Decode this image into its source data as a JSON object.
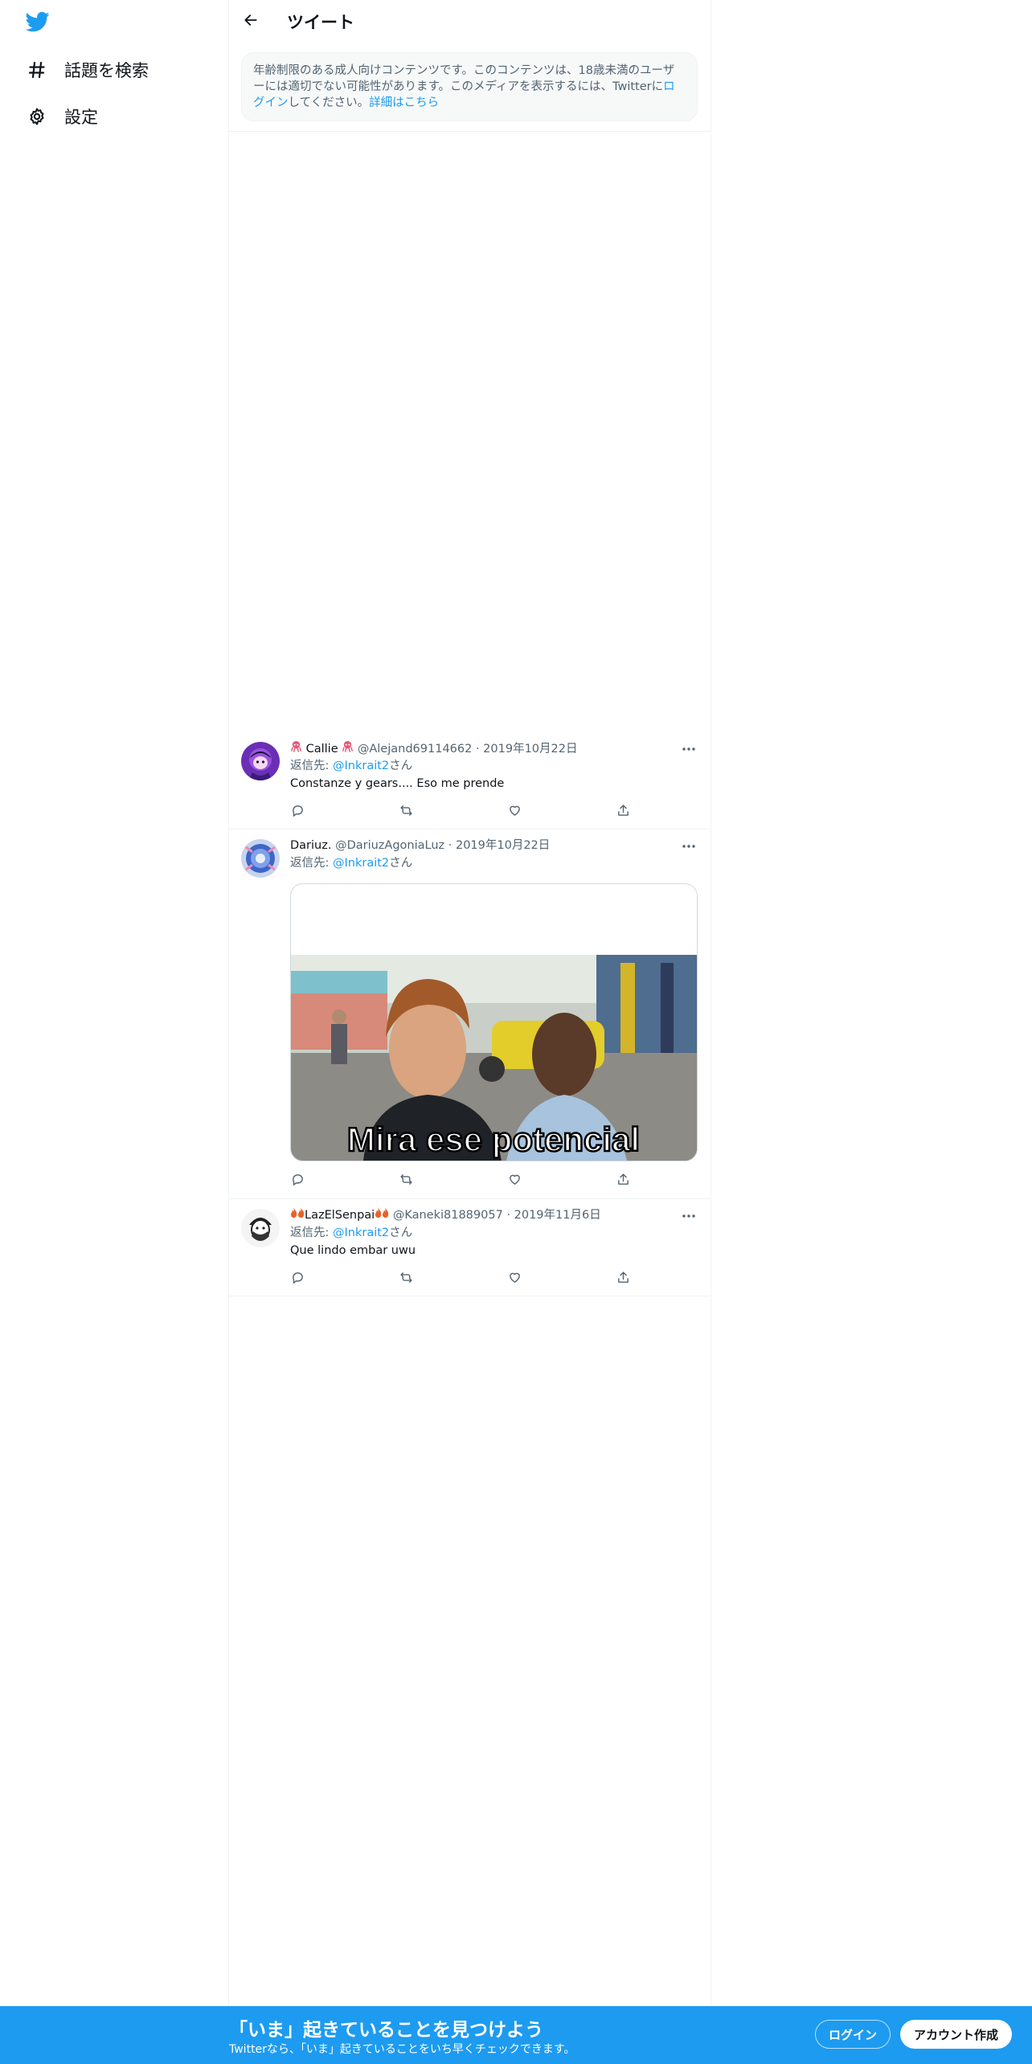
{
  "sidebar": {
    "logo_icon": "twitter-bird-icon",
    "items": [
      {
        "icon": "hashtag-icon",
        "label": "話題を検索"
      },
      {
        "icon": "gear-icon",
        "label": "設定"
      }
    ]
  },
  "header": {
    "back_icon": "arrow-left-icon",
    "title": "ツイート"
  },
  "notice": {
    "text_part1": "年齢制限のある成人向けコンテンツです。このコンテンツは、18歳未満のユーザーには適切でない可能性があります。このメディアを表示するには、Twitterに",
    "login_link": "ログイン",
    "text_part2": "してください。",
    "learn_more_link": "詳細はこちら"
  },
  "tweets": [
    {
      "name": "Callie",
      "name_emoji": "octopus",
      "handle": "@Alejand69114662",
      "dot": "·",
      "date": "2019年10月22日",
      "reply_label": "返信先: ",
      "reply_handle": "@Inkrait2",
      "reply_suffix": "さん",
      "text": "Constanze y gears.... Eso me prende"
    },
    {
      "name": "Dariuz.",
      "handle": "@DariuzAgoniaLuz",
      "dot": "·",
      "date": "2019年10月22日",
      "reply_label": "返信先: ",
      "reply_handle": "@Inkrait2",
      "reply_suffix": "さん",
      "media_caption": "Mira ese potencial"
    },
    {
      "name": "LazElSenpai",
      "name_emoji": "fire",
      "handle": "@Kaneki81889057",
      "dot": "·",
      "date": "2019年11月6日",
      "reply_label": "返信先: ",
      "reply_handle": "@Inkrait2",
      "reply_suffix": "さん",
      "text": "Que lindo embar uwu"
    }
  ],
  "tweet_actions": [
    "reply-icon",
    "retweet-icon",
    "like-icon",
    "share-icon"
  ],
  "bottom_bar": {
    "title": "「いま」起きていることを見つけよう",
    "subtitle": "Twitterなら、「いま」起きていることをいち早くチェックできます。",
    "login_label": "ログイン",
    "signup_label": "アカウント作成"
  },
  "colors": {
    "accent": "#1d9bf0",
    "text": "#0f1419",
    "muted": "#536471",
    "border": "#eff3f4"
  }
}
